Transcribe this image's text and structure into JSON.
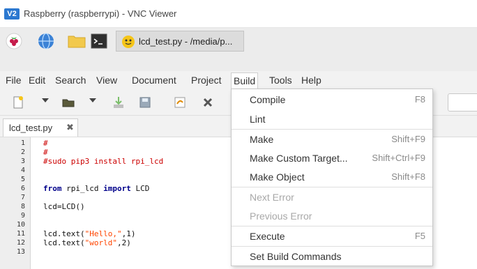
{
  "window": {
    "title": "Raspberry (raspberrypi) - VNC Viewer",
    "logo_text": "V2"
  },
  "taskbar": {
    "task_label": "lcd_test.py - /media/p..."
  },
  "menubar": {
    "items": [
      "File",
      "Edit",
      "Search",
      "View",
      "Document",
      "Project",
      "Build",
      "Tools",
      "Help"
    ],
    "active": "Build"
  },
  "tab": {
    "label": "lcd_test.py",
    "close": "✖"
  },
  "editor": {
    "line_numbers": [
      "1",
      "2",
      "3",
      "4",
      "5",
      "6",
      "7",
      "8",
      "9",
      "10",
      "11",
      "12",
      "13"
    ],
    "lines": {
      "l1": "#",
      "l2": "#",
      "l3": "#sudo pip3 install rpi_lcd",
      "l6_kw1": "from",
      "l6_mod": " rpi_lcd ",
      "l6_kw2": "import",
      "l6_name": " LCD",
      "l8": "lcd=LCD()",
      "l11_a": "lcd.text(",
      "l11_s": "\"Hello,\"",
      "l11_b": ",1)",
      "l12_a": "lcd.text(",
      "l12_s": "\"world\"",
      "l12_b": ",2)"
    }
  },
  "build_menu": {
    "items": [
      {
        "label": "Compile",
        "shortcut": "F8",
        "enabled": true
      },
      {
        "label": "Lint",
        "shortcut": "",
        "enabled": true
      },
      {
        "label": "Make",
        "shortcut": "Shift+F9",
        "enabled": true
      },
      {
        "label": "Make Custom Target...",
        "shortcut": "Shift+Ctrl+F9",
        "enabled": true
      },
      {
        "label": "Make Object",
        "shortcut": "Shift+F8",
        "enabled": true
      },
      {
        "label": "Next Error",
        "shortcut": "",
        "enabled": false
      },
      {
        "label": "Previous Error",
        "shortcut": "",
        "enabled": false
      },
      {
        "label": "Execute",
        "shortcut": "F5",
        "enabled": true
      },
      {
        "label": "Set Build Commands",
        "shortcut": "",
        "enabled": true
      }
    ]
  },
  "colors": {
    "comment": "#cc0000",
    "keyword": "#00008b",
    "string": "#ff4500",
    "vnc_blue": "#2b78d0"
  }
}
